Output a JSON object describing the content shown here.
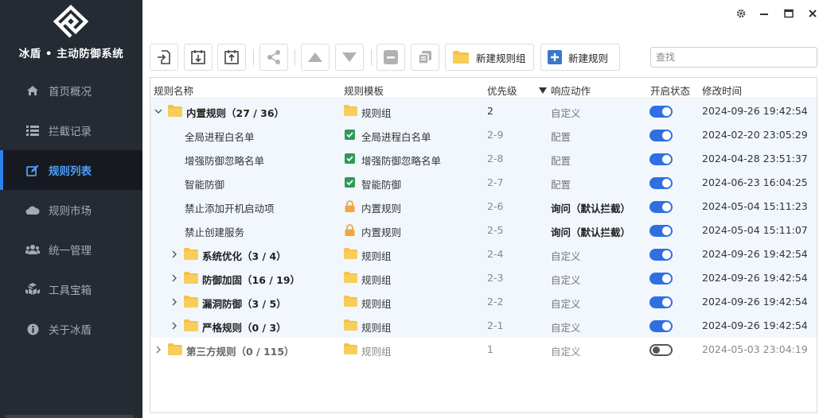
{
  "app": {
    "title": "冰盾 • 主动防御系统"
  },
  "nav": [
    {
      "label": "首页概况",
      "icon": "home-icon"
    },
    {
      "label": "拦截记录",
      "icon": "list-icon"
    },
    {
      "label": "规则列表",
      "icon": "edit-icon",
      "active": true
    },
    {
      "label": "规则市场",
      "icon": "cloud-icon"
    },
    {
      "label": "统一管理",
      "icon": "users-icon"
    },
    {
      "label": "工具宝箱",
      "icon": "cubes-icon"
    },
    {
      "label": "关于冰盾",
      "icon": "info-icon"
    }
  ],
  "toolbar": {
    "new_group_label": "新建规则组",
    "new_rule_label": "新建规则",
    "search_placeholder": "查找"
  },
  "table": {
    "headers": {
      "name": "规则名称",
      "template": "规则模板",
      "priority": "优先级",
      "action": "响应动作",
      "enabled": "开启状态",
      "modified": "修改时间"
    },
    "rows": [
      {
        "name": "内置规则（27 / 36）",
        "template": "规则组",
        "priority": "2",
        "action": "自定义",
        "enabled": true,
        "modified": "2024-09-26 19:42:54"
      },
      {
        "name": "全局进程白名单",
        "template": "全局进程白名单",
        "priority": "2-9",
        "action": "配置",
        "enabled": true,
        "modified": "2024-02-20 23:05:29"
      },
      {
        "name": "增强防御忽略名单",
        "template": "增强防御忽略名单",
        "priority": "2-8",
        "action": "配置",
        "enabled": true,
        "modified": "2024-04-28 23:51:37"
      },
      {
        "name": "智能防御",
        "template": "智能防御",
        "priority": "2-7",
        "action": "配置",
        "enabled": true,
        "modified": "2024-06-23 16:04:25"
      },
      {
        "name": "禁止添加开机启动项",
        "template": "内置规则",
        "priority": "2-6",
        "action": "询问（默认拦截）",
        "enabled": true,
        "modified": "2024-05-04 15:11:23"
      },
      {
        "name": "禁止创建服务",
        "template": "内置规则",
        "priority": "2-5",
        "action": "询问（默认拦截）",
        "enabled": true,
        "modified": "2024-05-04 15:11:07"
      },
      {
        "name": "系统优化（3 / 4）",
        "template": "规则组",
        "priority": "2-4",
        "action": "自定义",
        "enabled": true,
        "modified": "2024-09-26 19:42:54"
      },
      {
        "name": "防御加固（16 / 19）",
        "template": "规则组",
        "priority": "2-3",
        "action": "自定义",
        "enabled": true,
        "modified": "2024-09-26 19:42:54"
      },
      {
        "name": "漏洞防御（3 / 5）",
        "template": "规则组",
        "priority": "2-2",
        "action": "自定义",
        "enabled": true,
        "modified": "2024-09-26 19:42:54"
      },
      {
        "name": "严格规则（0 / 3）",
        "template": "规则组",
        "priority": "2-1",
        "action": "自定义",
        "enabled": true,
        "modified": "2024-09-26 19:42:54"
      },
      {
        "name": "第三方规则（0 / 115）",
        "template": "规则组",
        "priority": "1",
        "action": "自定义",
        "enabled": false,
        "modified": "2024-05-03 23:04:19"
      }
    ]
  },
  "colors": {
    "sidebar_bg": "#252b33",
    "active_nav": "#4d9ef6",
    "toggle_on": "#2f6fe0",
    "folder": "#f5c242",
    "check": "#2e9a57",
    "lock": "#f0a83c",
    "row_highlight": "#f1f7fd"
  }
}
